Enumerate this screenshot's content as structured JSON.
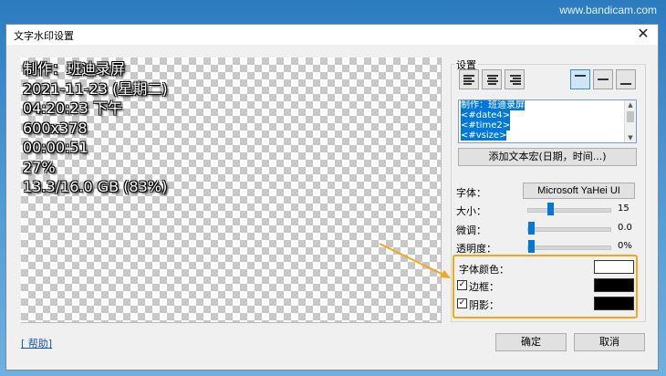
{
  "watermark": "www.bandicam.com",
  "dialog": {
    "title": "文字水印设置",
    "close_glyph": "✕"
  },
  "preview": {
    "lines": [
      "制作：班迪录屏",
      "2021-11-23 (星期二)",
      "04:20:23 下午",
      "600x378",
      "00:00:51",
      "27%",
      "13.3/16.0 GB (83%)"
    ]
  },
  "help_link": "[ 帮助]",
  "settings": {
    "group_label": "设置",
    "alignment_buttons": [
      "align-left",
      "align-center",
      "align-right"
    ],
    "position_buttons": [
      "position-top",
      "position-middle",
      "position-bottom"
    ],
    "text_lines": [
      "制作：班迪录屏",
      "<#date4>",
      "<#time2>",
      "<#vsize>"
    ],
    "add_macro_label": "添加文本宏(日期，时间...)",
    "font_label": "字体：",
    "font_value": "Microsoft YaHei UI",
    "size_label": "大小：",
    "size_value": "15",
    "adjust_label": "微调：",
    "adjust_value": "0.0",
    "opacity_label": "透明度：",
    "opacity_value": "0%",
    "font_color_label": "字体颜色：",
    "border_label": "边框：",
    "shadow_label": "阴影：",
    "colors": {
      "font": "#ffffff",
      "border": "#000000",
      "shadow": "#000000",
      "highlight": "#f0a81e",
      "accent": "#0078d7"
    }
  },
  "buttons": {
    "ok": "确定",
    "cancel": "取消"
  }
}
